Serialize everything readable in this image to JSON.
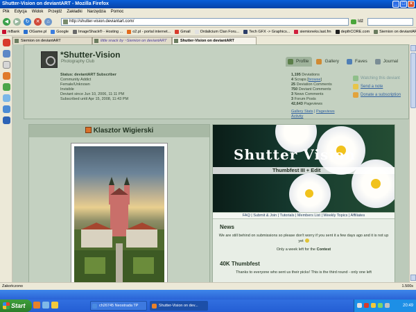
{
  "window": {
    "title": "Shutter-Vision on deviantART - Mozilla Firefox"
  },
  "menu": [
    "Plik",
    "Edycja",
    "Widok",
    "Przejdź",
    "Zakładki",
    "Narzędzia",
    "Pomoc"
  ],
  "nav": {
    "url": "http://shutter-vision.deviantart.com/",
    "go_label": "Idź"
  },
  "bookmarks": [
    {
      "label": "mBank",
      "color": "#c8102e"
    },
    {
      "label": "OGame.pl",
      "color": "#2a6fd0"
    },
    {
      "label": "Google",
      "color": "#3b7de0"
    },
    {
      "label": "ImageShack® - Hosting ...",
      "color": "#6a6a6a"
    },
    {
      "label": "o2.pl - portal internet...",
      "color": "#e36b1c"
    },
    {
      "label": "Gmail",
      "color": "#d83b2d"
    },
    {
      "label": "Ordalicium Clan Foru...",
      "color": "#e1e1e1"
    },
    {
      "label": "Tech GFX -> Graphics...",
      "color": "#2d3f6a"
    },
    {
      "label": "siemioneks.last.fm",
      "color": "#d01f3c"
    },
    {
      "label": "depthCORE.com",
      "color": "#1e1e1e"
    },
    {
      "label": "Siemion on deviantART",
      "color": "#6a7c5f"
    }
  ],
  "tabs": [
    {
      "label": "Siemion on deviantART",
      "active": false
    },
    {
      "label": "little snack by ~Siemion on deviantART",
      "active": false
    },
    {
      "label": "Shutter-Vision on deviantART",
      "active": true
    }
  ],
  "profile": {
    "username": "*Shutter-Vision",
    "subtitle": "Photography Club",
    "tabs": [
      "Profile",
      "Gallery",
      "Faves",
      "Journal"
    ],
    "status_lines": [
      "Status: deviantART Subscriber",
      "Community Addict",
      "Female/Unknown",
      "Invisible",
      "Deviant since Jun 10, 2006, 11:11 PM",
      "Subscribed until Apr 15, 2008, 11:43 PM"
    ],
    "stats": [
      {
        "num": "1,195",
        "label": "Deviations"
      },
      {
        "num": "4",
        "label": "Scraps",
        "extra": "browse"
      },
      {
        "num": "25",
        "label": "Deviation Comments"
      },
      {
        "num": "750",
        "label": "Deviant Comments"
      },
      {
        "num": "3",
        "label": "News Comments"
      },
      {
        "num": "3",
        "label": "Forum Posts"
      },
      {
        "num": "42,643",
        "label": "Pageviews"
      }
    ],
    "stat_links": [
      "Gallery Stats",
      "Pageviews",
      "Activity"
    ],
    "actions": [
      {
        "label": "Watching this deviant",
        "muted": true,
        "color": "#8fbf8a"
      },
      {
        "label": "Send a note",
        "muted": false,
        "color": "#e8c54a"
      },
      {
        "label": "Donate a subscription",
        "muted": false,
        "color": "#e2a33d"
      }
    ]
  },
  "left_panel": {
    "title": "Klasztor Wigierski"
  },
  "right_panel": {
    "banner_title": "Shutter Vision",
    "banner_subtitle": "Thumbfest III + Edit",
    "nav_links": "FAQ | Submit & Join | Tutorials | Members List | Weekly Topics | Affiliates",
    "news_title": "News",
    "news_line1": "We are still behind on submissions so please don't worry if you sent it a few days ago and it is not up yet",
    "news_line2_prefix": "Only a week left for the",
    "news_line2_bold": "Contest",
    "thumbfest_title": "40K Thumbfest",
    "thumbfest_text": "Thanks to everyone who sent us their picks! This is the third round - only one left"
  },
  "statusbar": {
    "left": "Zakończono",
    "right": "1.500s"
  },
  "taskbar": {
    "start": "Start",
    "items": [
      {
        "label": "ch26745 Neostrada TP",
        "active": false
      },
      {
        "label": "Shutter-Vision on dev...",
        "active": true
      }
    ],
    "clock": "20:49"
  },
  "colors": {
    "accent": "#2f5f9f",
    "page_bg": "#bccaba",
    "panel": "#c4d1c1"
  }
}
